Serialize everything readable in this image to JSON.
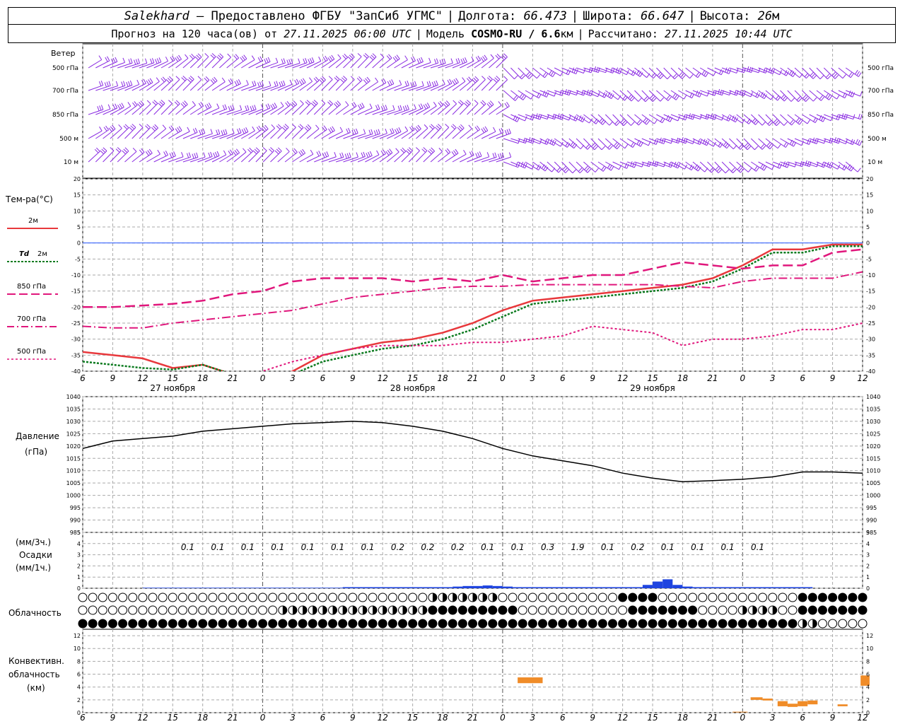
{
  "header": {
    "station": "Salekhard",
    "provider": "– Предоставлено ФГБУ \"ЗапСиб УГМС\"",
    "lon_label": "Долгота:",
    "lon_value": "66.473",
    "lat_label": "Широта:",
    "lat_value": "66.647",
    "alt_label": "Высота:",
    "alt_value": "26",
    "alt_unit": "м",
    "forecast_prefix": "Прогноз на 120 часа(ов) от",
    "forecast_time": "27.11.2025 06:00 UTC",
    "model_label": "Модель",
    "model_name": "COSMO-RU / 6.6",
    "model_unit": "км",
    "computed_label": "Рассчитано:",
    "computed_time": "27.11.2025 10:44 UTC"
  },
  "colors": {
    "t2m": "#e8383c",
    "td2m": "#0a7a1e",
    "t850": "#e0177c",
    "t700": "#e0177c",
    "t500": "#e0177c",
    "pressure": "#000000",
    "precip": "#1f45e0",
    "convective": "#f08c28",
    "wind": "#8a2be2",
    "zero_line": "#2255ff"
  },
  "x_axis": {
    "hour_ticks": [
      "6",
      "9",
      "12",
      "15",
      "18",
      "21",
      "0",
      "3",
      "6",
      "9",
      "12",
      "15",
      "18",
      "21",
      "0",
      "3",
      "6",
      "9",
      "12",
      "15",
      "18",
      "21",
      "0",
      "3",
      "6",
      "9",
      "12"
    ],
    "dates": [
      "27 ноября",
      "28 ноября",
      "29 ноября"
    ]
  },
  "wind_panel": {
    "title": "Ветер",
    "levels": [
      "500 гПа",
      "700 гПа",
      "850 гПа",
      "500 м",
      "10 м"
    ],
    "right_levels": [
      "500 гПа",
      "700 гПа",
      "850 гПа",
      "500 м",
      "10 м"
    ]
  },
  "temp_panel": {
    "title": "Тем-ра(°С)",
    "legend": [
      {
        "label": "2м",
        "prefix": ""
      },
      {
        "label": "2м",
        "prefix": "Td"
      },
      {
        "label": "850 гПа",
        "prefix": ""
      },
      {
        "label": "700 гПа",
        "prefix": ""
      },
      {
        "label": "500 гПа",
        "prefix": ""
      }
    ]
  },
  "pressure_panel": {
    "title": "Давление",
    "unit": "(гПа)"
  },
  "precip_panel": {
    "label_top": "(мм/3ч.)",
    "title": "Осадки",
    "label_bottom": "(мм/1ч.)"
  },
  "cloud_panel": {
    "title": "Облачность"
  },
  "conv_panel": {
    "title_1": "Конвективн.",
    "title_2": "облачность",
    "unit": "(км)"
  },
  "chart_data": [
    {
      "type": "line",
      "name": "temperature",
      "x": [
        0,
        3,
        6,
        9,
        12,
        15,
        18,
        21,
        24,
        27,
        30,
        33,
        36,
        39,
        42,
        45,
        48,
        51,
        54,
        57,
        60,
        63,
        66,
        69,
        72,
        75,
        78
      ],
      "ylim": [
        -40,
        20
      ],
      "yticks": [
        20,
        15,
        10,
        5,
        0,
        -5,
        -10,
        -15,
        -20,
        -25,
        -30,
        -35,
        -40
      ],
      "series": [
        {
          "key": "t2m",
          "values": [
            -34,
            -35,
            -36,
            -39,
            -38,
            -41,
            -44,
            -40,
            -35,
            -33,
            -31,
            -30,
            -28,
            -25,
            -21,
            -18,
            -17,
            -16,
            -15,
            -14,
            -13,
            -11,
            -7,
            -2,
            -2,
            -0.5,
            -0.5
          ]
        },
        {
          "key": "td2m",
          "values": [
            -37,
            -38,
            -39,
            -39.5,
            -38,
            -41,
            -45,
            -41,
            -37,
            -35,
            -33,
            -32,
            -30,
            -27,
            -23,
            -19,
            -18,
            -17,
            -16,
            -15,
            -14,
            -12,
            -8,
            -3,
            -3,
            -1,
            -1
          ]
        },
        {
          "key": "t850",
          "values": [
            -20,
            -20,
            -19.5,
            -19,
            -18,
            -16,
            -15,
            -12,
            -11,
            -11,
            -11,
            -12,
            -11,
            -12,
            -10,
            -12,
            -11,
            -10,
            -10,
            -8,
            -6,
            -7,
            -8,
            -7,
            -7,
            -3,
            -2
          ]
        },
        {
          "key": "t700",
          "values": [
            -26,
            -26.5,
            -26.5,
            -25,
            -24,
            -23,
            -22,
            -21,
            -19,
            -17,
            -16,
            -15,
            -14,
            -13.5,
            -13.5,
            -13,
            -13,
            -13,
            -13,
            -13,
            -13.5,
            -14,
            -12,
            -11,
            -11,
            -11,
            -9
          ]
        },
        {
          "key": "t500",
          "values": [
            -43,
            -43,
            -43,
            -43,
            -43,
            -43,
            -40,
            -37,
            -35,
            -33,
            -32,
            -32,
            -32,
            -31,
            -31,
            -30,
            -29,
            -26,
            -27,
            -28,
            -32,
            -30,
            -30,
            -29,
            -27,
            -27,
            -25
          ]
        }
      ]
    },
    {
      "type": "line",
      "name": "pressure",
      "x": [
        0,
        3,
        6,
        9,
        12,
        15,
        18,
        21,
        24,
        27,
        30,
        33,
        36,
        39,
        42,
        45,
        48,
        51,
        54,
        57,
        60,
        63,
        66,
        69,
        72,
        75,
        78
      ],
      "ylim": [
        985,
        1040
      ],
      "yticks": [
        1040,
        1035,
        1030,
        1025,
        1020,
        1015,
        1010,
        1005,
        1000,
        995,
        990,
        985
      ],
      "values": [
        1019,
        1022,
        1023,
        1024,
        1026,
        1027,
        1028,
        1029,
        1029.5,
        1030,
        1029.5,
        1028,
        1026,
        1023,
        1019,
        1016,
        1014,
        1012,
        1009,
        1007,
        1005.5,
        1006,
        1006.5,
        1007.5,
        1009.5,
        1009.5,
        1009
      ]
    },
    {
      "type": "bar",
      "name": "precipitation",
      "ylim": [
        0,
        5
      ],
      "yticks": [
        5,
        4,
        3,
        2,
        1,
        0
      ],
      "x_3h": [
        12,
        15,
        18,
        21,
        24,
        27,
        30,
        33,
        36,
        39,
        42,
        45,
        48,
        51,
        54,
        57,
        60,
        63,
        66,
        69
      ],
      "labels_3h": [
        "0.1",
        "0.1",
        "0.1",
        "0.1",
        "0.1",
        "0.1",
        "0.1",
        "0.2",
        "0.2",
        "0.2",
        "0.1",
        "0.1",
        "0.3",
        "1.9",
        "0.1",
        "0.2",
        "0.1",
        "0.1",
        "0.1",
        "0.1"
      ],
      "hourly_values": [
        0,
        0,
        0,
        0,
        0,
        0,
        0,
        0,
        0,
        0,
        0,
        0,
        0.05,
        0.05,
        0.05,
        0.05,
        0.05,
        0.05,
        0.05,
        0.05,
        0.05,
        0.05,
        0.05,
        0.05,
        0.05,
        0.05,
        0.05,
        0.05,
        0.05,
        0.05,
        0.05,
        0.05,
        0.1,
        0.1,
        0.1,
        0.1,
        0.1,
        0.1,
        0.1,
        0.1,
        0.1,
        0.1,
        0.1,
        0.15,
        0.2,
        0.2,
        0.25,
        0.2,
        0.15,
        0.1,
        0.1,
        0.1,
        0.1,
        0.1,
        0.1,
        0.1,
        0.1,
        0.1,
        0.1,
        0.1,
        0.1,
        0.1,
        0.3,
        0.6,
        0.8,
        0.3,
        0.15,
        0.1,
        0.1,
        0.1,
        0.1,
        0.1,
        0.1,
        0.1,
        0.1,
        0.1,
        0.1,
        0.1,
        0.1,
        0,
        0,
        0,
        0,
        0,
        0,
        0,
        0,
        0,
        0
      ]
    },
    {
      "type": "bar",
      "name": "convective_cloud",
      "ylim": [
        0,
        13
      ],
      "yticks": [
        12,
        10,
        8,
        6,
        4,
        2,
        0
      ],
      "bars": [
        {
          "x0": 43.5,
          "x1": 46,
          "bottom": 4.6,
          "top": 5.5
        },
        {
          "x0": 65,
          "x1": 66.5,
          "bottom": 0.05,
          "top": 0.15
        },
        {
          "x0": 66.8,
          "x1": 68,
          "bottom": 2.0,
          "top": 2.4
        },
        {
          "x0": 68,
          "x1": 69,
          "bottom": 1.9,
          "top": 2.2
        },
        {
          "x0": 69.5,
          "x1": 70.5,
          "bottom": 1.0,
          "top": 1.8
        },
        {
          "x0": 70.5,
          "x1": 71.5,
          "bottom": 0.9,
          "top": 1.4
        },
        {
          "x0": 71.5,
          "x1": 72.5,
          "bottom": 1.0,
          "top": 1.8
        },
        {
          "x0": 72.5,
          "x1": 73.5,
          "bottom": 1.3,
          "top": 1.9
        },
        {
          "x0": 75.5,
          "x1": 76.5,
          "bottom": 1.0,
          "top": 1.3
        },
        {
          "x0": 77.8,
          "x1": 78.7,
          "bottom": 4.2,
          "top": 5.8
        }
      ]
    }
  ]
}
